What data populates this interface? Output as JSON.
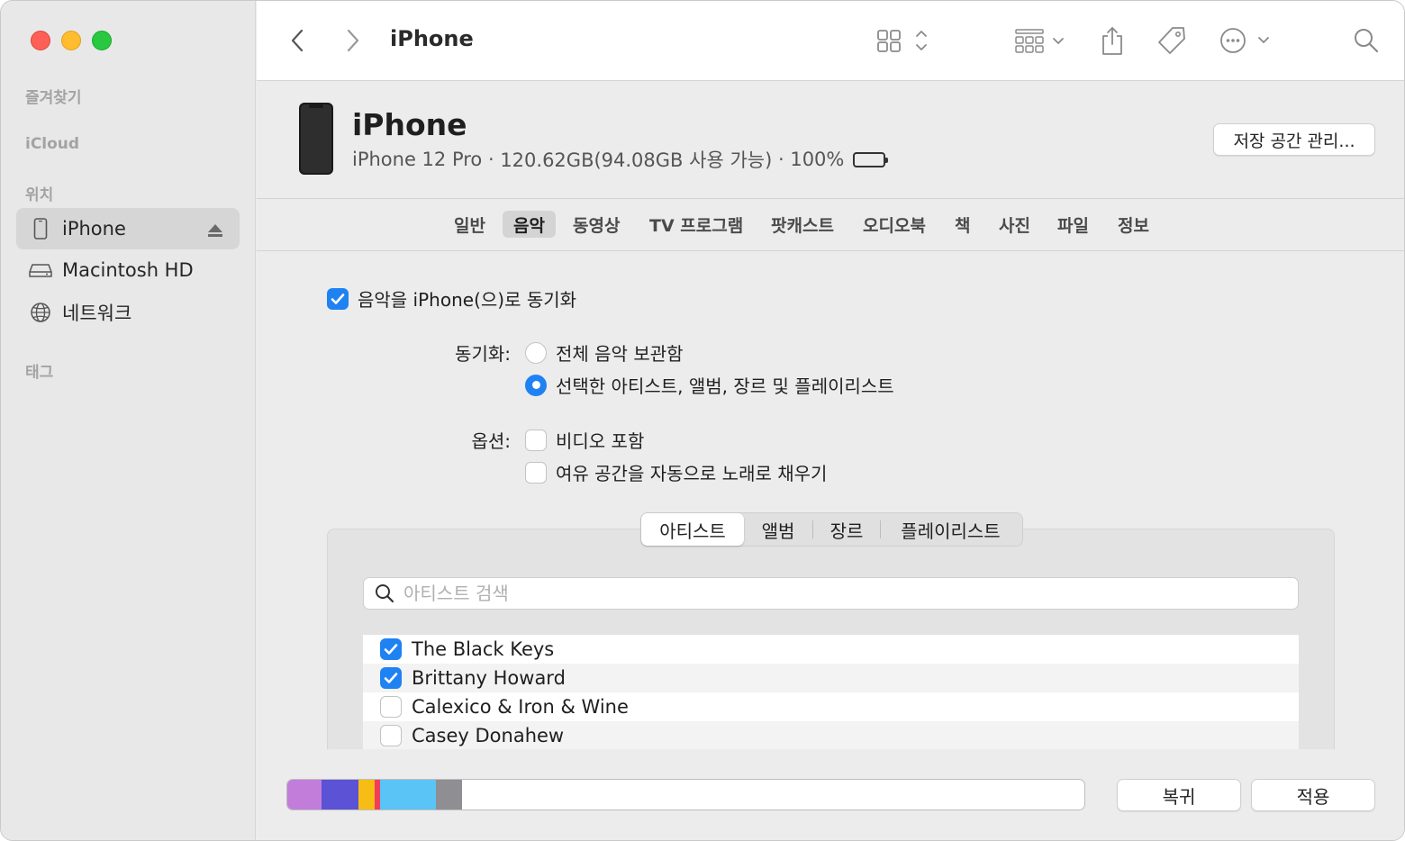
{
  "sidebar": {
    "sections": {
      "favorites": "즐겨찾기",
      "icloud": "iCloud",
      "locations": "위치",
      "tags": "태그"
    },
    "items": [
      {
        "label": "iPhone",
        "icon": "iphone-icon",
        "selected": true
      },
      {
        "label": "Macintosh HD",
        "icon": "hard-drive-icon"
      },
      {
        "label": "네트워크",
        "icon": "network-globe-icon"
      }
    ]
  },
  "toolbar": {
    "title": "iPhone"
  },
  "device": {
    "name": "iPhone",
    "model": "iPhone 12 Pro",
    "capacity": "120.62GB(94.08GB 사용 가능)",
    "battery": "100%",
    "separator": " · ",
    "manage_storage": "저장 공간 관리..."
  },
  "tabs": [
    {
      "label": "일반"
    },
    {
      "label": "음악",
      "active": true
    },
    {
      "label": "동영상"
    },
    {
      "label": "TV 프로그램"
    },
    {
      "label": "팟캐스트"
    },
    {
      "label": "오디오북"
    },
    {
      "label": "책"
    },
    {
      "label": "사진"
    },
    {
      "label": "파일"
    },
    {
      "label": "정보"
    }
  ],
  "music": {
    "sync_checkbox": {
      "label": "음악을 iPhone(으)로 동기화",
      "checked": true
    },
    "sync_label": "동기화:",
    "sync_options": [
      {
        "label": "전체 음악 보관함",
        "selected": false
      },
      {
        "label": "선택한 아티스트, 앨범, 장르 및 플레이리스트",
        "selected": true
      }
    ],
    "options_label": "옵션:",
    "options": [
      {
        "label": "비디오 포함",
        "checked": false
      },
      {
        "label": "여유 공간을 자동으로 노래로 채우기",
        "checked": false
      }
    ],
    "segments": [
      {
        "label": "아티스트",
        "active": true
      },
      {
        "label": "앨범"
      },
      {
        "label": "장르"
      },
      {
        "label": "플레이리스트"
      }
    ],
    "search_placeholder": "아티스트 검색",
    "artists": [
      {
        "name": "The Black Keys",
        "checked": true
      },
      {
        "name": "Brittany Howard",
        "checked": true
      },
      {
        "name": "Calexico & Iron & Wine",
        "checked": false
      },
      {
        "name": "Casey Donahew",
        "checked": false
      }
    ]
  },
  "storage_bar": {
    "segments": [
      {
        "color": "#c27ddb",
        "fraction": 0.043
      },
      {
        "color": "#5b52d6",
        "fraction": 0.046
      },
      {
        "color": "#f7bd14",
        "fraction": 0.021
      },
      {
        "color": "#f33b5a",
        "fraction": 0.006
      },
      {
        "color": "#5ac4f7",
        "fraction": 0.071
      },
      {
        "color": "#8e8e93",
        "fraction": 0.032
      }
    ]
  },
  "buttons": {
    "revert": "복귀",
    "apply": "적용"
  },
  "colors": {
    "accent": "#1f82f2"
  }
}
